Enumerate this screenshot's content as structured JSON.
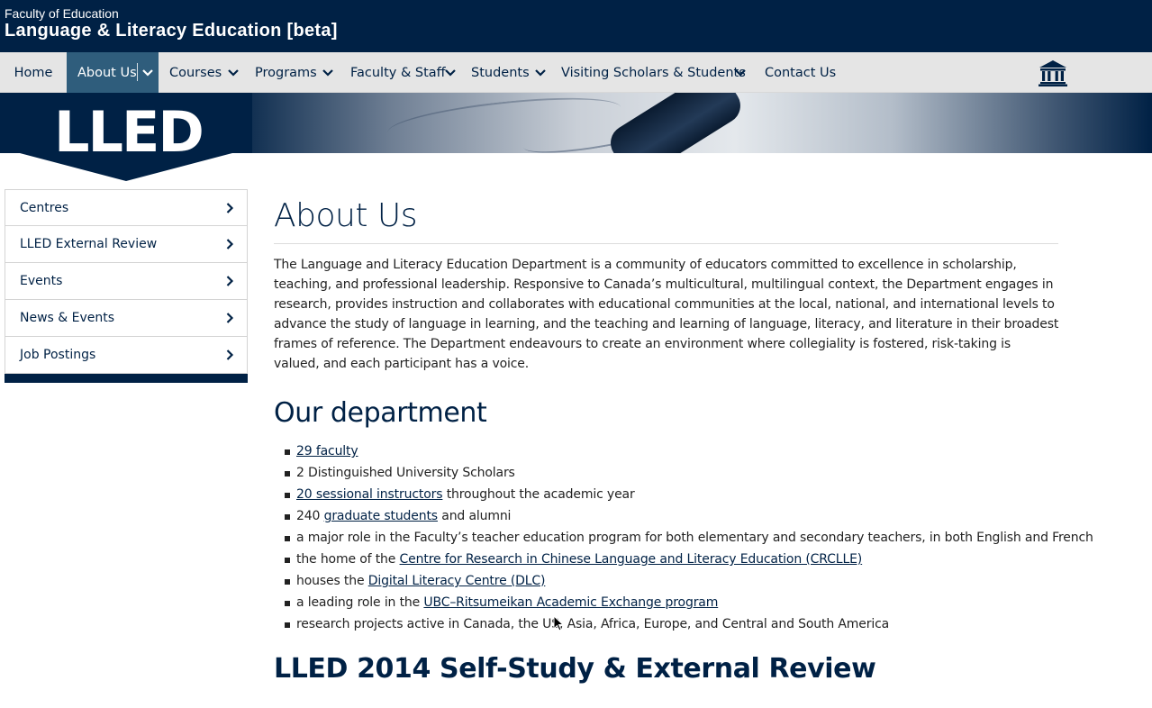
{
  "header": {
    "faculty": "Faculty of Education",
    "unit_title": "Language & Literacy Education [beta]"
  },
  "nav": {
    "items": [
      {
        "label": "Home"
      },
      {
        "label": "About Us",
        "active": true
      },
      {
        "label": "Courses"
      },
      {
        "label": "Programs"
      },
      {
        "label": "Faculty & Staff"
      },
      {
        "label": "Students"
      },
      {
        "label": "Visiting Scholars & Students"
      },
      {
        "label": "Contact Us"
      }
    ],
    "logo_icon": "ubc-building-icon"
  },
  "banner": {
    "badge_text": "LLED"
  },
  "sidebar": {
    "items": [
      {
        "label": "Centres"
      },
      {
        "label": "LLED External Review"
      },
      {
        "label": "Events"
      },
      {
        "label": "News & Events"
      },
      {
        "label": "Job Postings"
      }
    ]
  },
  "main": {
    "title": "About Us",
    "intro": "The Language and Literacy Education Department is a community of educators committed to excellence in scholarship, teaching, and professional leadership. Responsive to Canada’s multicultural, multilingual context, the Department engages in research, provides instruction and collaborates with educational communities at the local, national, and international levels to advance the study of language in learning, and the teaching and learning of language, literacy, and literature in their broadest frames of reference. The Department endeavours to create an environment where collegiality is fostered, risk-taking is valued, and each participant has a voice.",
    "department_heading": "Our department",
    "facts": [
      {
        "pre": "",
        "link": "29 faculty",
        "post": ""
      },
      {
        "pre": "2 Distinguished University Scholars",
        "link": "",
        "post": ""
      },
      {
        "pre": "",
        "link": "20 sessional instructors",
        "post": " throughout the academic year"
      },
      {
        "pre": "240 ",
        "link": "graduate students",
        "post": " and alumni"
      },
      {
        "pre": "a major role in the Faculty’s teacher education program for both elementary and secondary teachers, in both English and French",
        "link": "",
        "post": ""
      },
      {
        "pre": "the home of the ",
        "link": "Centre for Research in Chinese Language and Literacy Education (CRCLLE)",
        "post": ""
      },
      {
        "pre": "houses the ",
        "link": "Digital Literacy Centre (DLC)",
        "post": ""
      },
      {
        "pre": "a leading role in the ",
        "link": "UBC–Ritsumeikan Academic Exchange program",
        "post": ""
      },
      {
        "pre": "research projects active in Canada, the US, Asia, Africa, Europe, and Central and South America",
        "link": "",
        "post": ""
      }
    ],
    "review_heading": "LLED 2014 Self-Study & External Review"
  },
  "colors": {
    "brand_navy": "#002145",
    "nav_bg": "#e5e5e5",
    "nav_active": "#2f5d7c"
  }
}
